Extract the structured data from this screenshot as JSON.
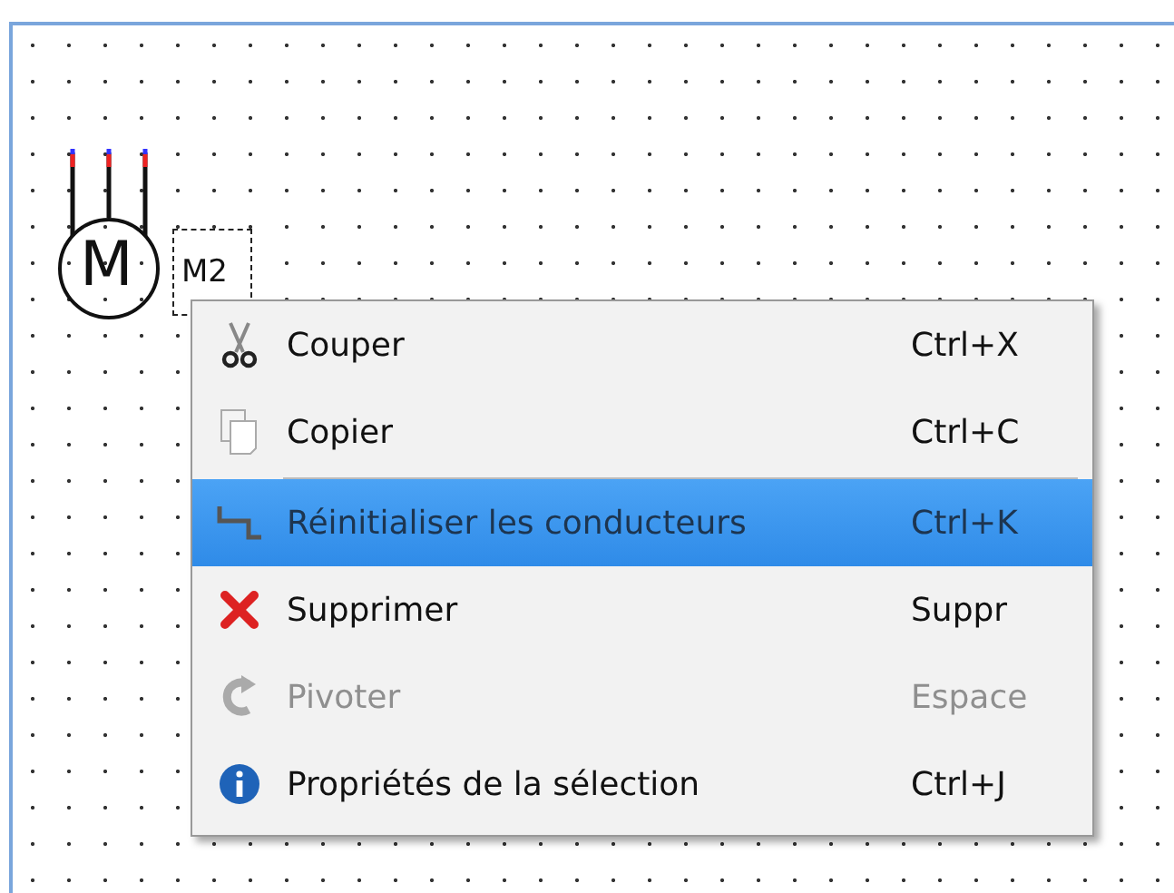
{
  "canvas": {
    "motor": {
      "symbol": "M",
      "label": "M2"
    }
  },
  "context_menu": {
    "items": [
      {
        "kind": "item",
        "label": "Couper",
        "shortcut": "Ctrl+X",
        "disabled": false,
        "selected": false
      },
      {
        "kind": "item",
        "label": "Copier",
        "shortcut": "Ctrl+C",
        "disabled": false,
        "selected": false
      },
      {
        "kind": "separator"
      },
      {
        "kind": "item",
        "label": "Réinitialiser les conducteurs",
        "shortcut": "Ctrl+K",
        "disabled": true,
        "selected": true
      },
      {
        "kind": "item",
        "label": "Supprimer",
        "shortcut": "Suppr",
        "disabled": false,
        "selected": false
      },
      {
        "kind": "item",
        "label": "Pivoter",
        "shortcut": "Espace",
        "disabled": true,
        "selected": false
      },
      {
        "kind": "item",
        "label": "Propriétés de la sélection",
        "shortcut": "Ctrl+J",
        "disabled": false,
        "selected": false
      }
    ]
  }
}
